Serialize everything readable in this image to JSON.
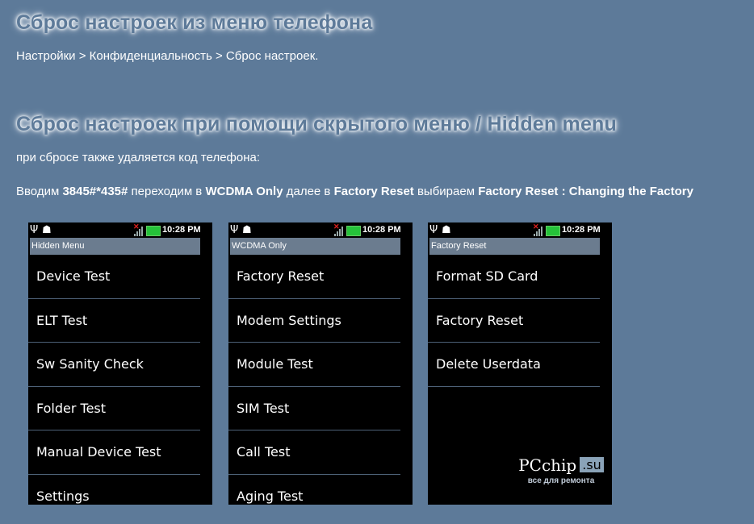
{
  "headings": {
    "h1": "Сброс настроек из меню телефона",
    "h2": "Сброс настроек при помощи скрытого меню / Hidden menu"
  },
  "breadcrumb": "Настройки > Конфиденциальность > Сброс настроек.",
  "note": "при сбросе также удаляется код телефона:",
  "instruction": {
    "t1": "Вводим ",
    "code": "3845#*435#",
    "t2": " переходим в ",
    "menu1": "WCDMA Only",
    "t3": " далее в ",
    "menu2": "Factory Reset",
    "t4": " выбираем ",
    "menu3": "Factory Reset : Changing the Factory"
  },
  "phones": [
    {
      "time": "10:28 PM",
      "title": "Hidden Menu",
      "items": [
        "Device Test",
        "ELT Test",
        "Sw Sanity Check",
        "Folder Test",
        "Manual Device Test",
        "Settings"
      ]
    },
    {
      "time": "10:28 PM",
      "title": "WCDMA Only",
      "items": [
        "Factory Reset",
        "Modem Settings",
        "Module Test",
        "SIM Test",
        "Call Test",
        "Aging Test"
      ]
    },
    {
      "time": "10:28 PM",
      "title": "Factory Reset",
      "items": [
        "Format SD Card",
        "Factory Reset",
        "Delete Userdata"
      ]
    }
  ],
  "watermark": {
    "brand": "PCchip",
    "tld": ".su",
    "tagline": "все для ремонта"
  },
  "colors": {
    "background": "#5d7a99",
    "titlebar": "#6b7c8f",
    "battery": "#25c23a"
  }
}
